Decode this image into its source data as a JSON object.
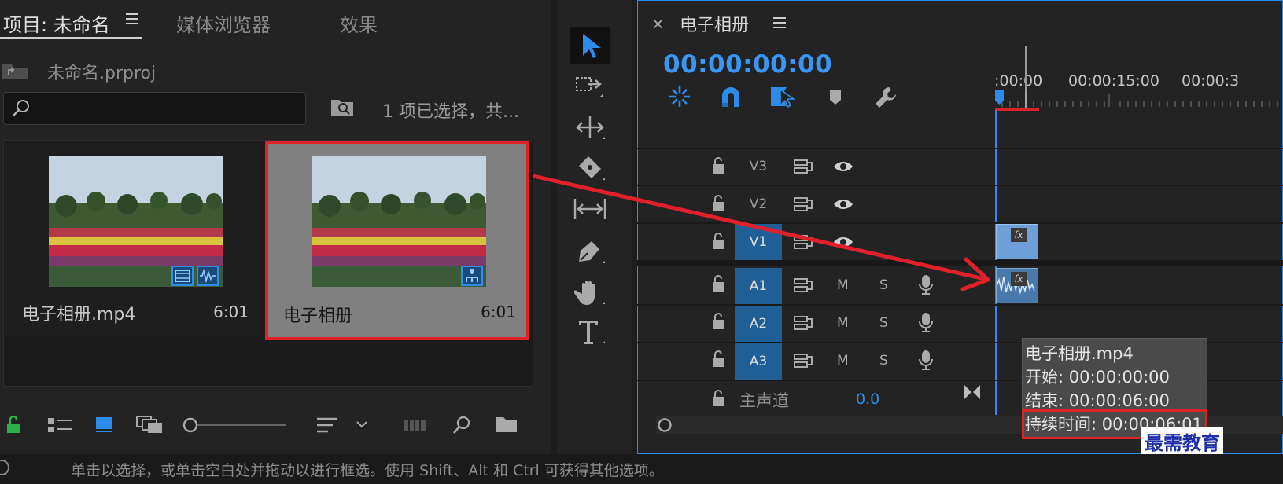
{
  "project_panel": {
    "tabs": [
      {
        "label": "项目: 未命名"
      },
      {
        "label": "媒体浏览器"
      },
      {
        "label": "效果"
      }
    ],
    "project_file": "未命名.prproj",
    "search_value": "",
    "selection_info": "1 项已选择，共...",
    "clips": [
      {
        "name": "电子相册.mp4",
        "duration": "6:01"
      },
      {
        "name": "电子相册",
        "duration": "6:01"
      }
    ]
  },
  "timeline": {
    "title": "电子相册",
    "timecode": "00:00:00:00",
    "ruler": [
      ":00:00",
      "00:00:15:00",
      "00:00:3"
    ],
    "video_tracks": [
      {
        "label": "V3",
        "targeted": false
      },
      {
        "label": "V2",
        "targeted": false
      },
      {
        "label": "V1",
        "targeted": true
      }
    ],
    "audio_tracks": [
      {
        "label": "A1",
        "mute": "M",
        "solo": "S",
        "targeted": true
      },
      {
        "label": "A2",
        "mute": "M",
        "solo": "S",
        "targeted": true
      },
      {
        "label": "A3",
        "mute": "M",
        "solo": "S",
        "targeted": true
      }
    ],
    "master": {
      "label": "主声道",
      "value": "0.0"
    },
    "clip_fx_label": "fx",
    "tooltip": {
      "name": "电子相册.mp4",
      "start": "开始: 00:00:00:00",
      "end": "结束: 00:00:06:00",
      "duration": "持续时间: 00:00:06:01"
    }
  },
  "status_bar": {
    "text": "单击以选择，或单击空白处并拖动以进行框选。使用 Shift、Alt 和 Ctrl 可获得其他选项。"
  },
  "watermark": "最需教育",
  "colors": {
    "accent": "#2d8ceb",
    "highlight_box": "#e0202a",
    "track_target": "#1f5f95",
    "timecode": "#3a96f5"
  }
}
